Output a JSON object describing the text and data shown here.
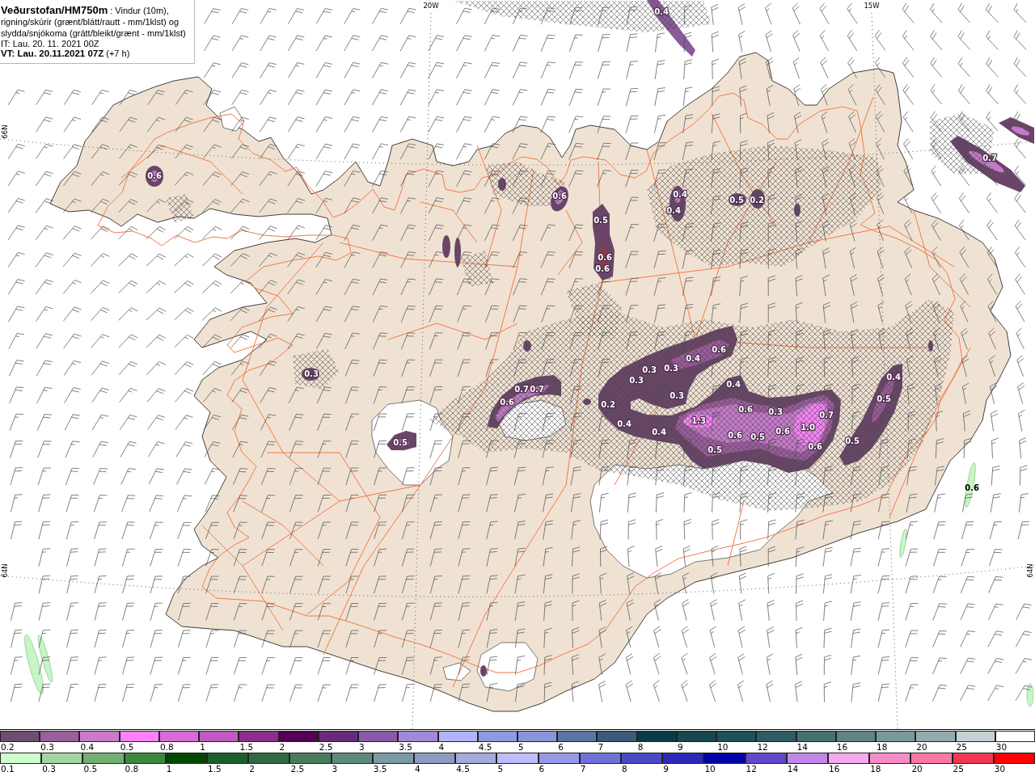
{
  "header": {
    "description": "**Veðurstofan/HM750m** : Vindur (10m), rigning/skúrir (grænt/blátt/rautt - mm/1klst) og slydda/snjókoma (grátt/bleikt/grænt - mm/1klst)",
    "initial_time": "IT: Lau. 20. 11. 2021 00Z",
    "valid_time": "**VT: Lau. 20.11.2021 07Z** (+7 h)"
  },
  "map": {
    "grid_labels": [
      {
        "text": "20W",
        "kind": "longitude"
      },
      {
        "text": "15W",
        "kind": "longitude"
      },
      {
        "text": "66N",
        "kind": "latitude"
      },
      {
        "text": "64N",
        "kind": "latitude"
      },
      {
        "text": "64N",
        "kind": "latitude"
      }
    ],
    "precipitation_labels": [
      {
        "text": "0.6",
        "kind": "snow"
      },
      {
        "text": "0.6",
        "kind": "snow"
      },
      {
        "text": "0.4",
        "kind": "snow"
      },
      {
        "text": "0.4",
        "kind": "snow"
      },
      {
        "text": "0.5",
        "kind": "snow"
      },
      {
        "text": "0.2",
        "kind": "snow"
      },
      {
        "text": "0.5",
        "kind": "snow"
      },
      {
        "text": "0.6",
        "kind": "snow"
      },
      {
        "text": "0.6",
        "kind": "snow"
      },
      {
        "text": "0.3",
        "kind": "snow"
      },
      {
        "text": "0.6",
        "kind": "snow"
      },
      {
        "text": "0.7",
        "kind": "snow"
      },
      {
        "text": "0.7",
        "kind": "snow"
      },
      {
        "text": "0.5",
        "kind": "snow"
      },
      {
        "text": "0.6",
        "kind": "snow"
      },
      {
        "text": "0.4",
        "kind": "snow"
      },
      {
        "text": "0.3",
        "kind": "snow"
      },
      {
        "text": "0.3",
        "kind": "snow"
      },
      {
        "text": "0.3",
        "kind": "snow"
      },
      {
        "text": "0.3",
        "kind": "snow"
      },
      {
        "text": "0.2",
        "kind": "snow"
      },
      {
        "text": "0.4",
        "kind": "snow"
      },
      {
        "text": "0.6",
        "kind": "snow"
      },
      {
        "text": "0.3",
        "kind": "snow"
      },
      {
        "text": "0.7",
        "kind": "snow"
      },
      {
        "text": "0.4",
        "kind": "snow"
      },
      {
        "text": "0.4",
        "kind": "snow"
      },
      {
        "text": "1.3",
        "kind": "snow"
      },
      {
        "text": "0.6",
        "kind": "snow"
      },
      {
        "text": "0.5",
        "kind": "snow"
      },
      {
        "text": "0.6",
        "kind": "snow"
      },
      {
        "text": "1.0",
        "kind": "snow"
      },
      {
        "text": "0.6",
        "kind": "snow"
      },
      {
        "text": "0.5",
        "kind": "snow"
      },
      {
        "text": "0.4",
        "kind": "snow"
      },
      {
        "text": "0.5",
        "kind": "snow"
      },
      {
        "text": "0.5",
        "kind": "snow"
      },
      {
        "text": "0.7",
        "kind": "snow"
      },
      {
        "text": "0.6",
        "kind": "rain"
      },
      {
        "text": "0.4",
        "kind": "snow"
      }
    ]
  },
  "legend": {
    "sleet_snow_scale": [
      {
        "label": "0.2",
        "color": "#6e4d6e"
      },
      {
        "label": "0.3",
        "color": "#9b5f9b"
      },
      {
        "label": "0.4",
        "color": "#c97bc9"
      },
      {
        "label": "0.5",
        "color": "#ff80ff"
      },
      {
        "label": "0.8",
        "color": "#d96bd9"
      },
      {
        "label": "1",
        "color": "#c259c2"
      },
      {
        "label": "1.5",
        "color": "#8c2e8c"
      },
      {
        "label": "2",
        "color": "#540054"
      },
      {
        "label": "2.5",
        "color": "#6a2a7a"
      },
      {
        "label": "3",
        "color": "#8a5aaa"
      },
      {
        "label": "3.5",
        "color": "#9e8ad6"
      },
      {
        "label": "4",
        "color": "#b0b4ff"
      },
      {
        "label": "4.5",
        "color": "#8c9ae0"
      },
      {
        "label": "5",
        "color": "#8a94d8"
      },
      {
        "label": "6",
        "color": "#5c74a4"
      },
      {
        "label": "7",
        "color": "#3a5a7a"
      },
      {
        "label": "8",
        "color": "#0a3c48"
      },
      {
        "label": "9",
        "color": "#16484e"
      },
      {
        "label": "10",
        "color": "#1e5058"
      },
      {
        "label": "12",
        "color": "#2e5c62"
      },
      {
        "label": "14",
        "color": "#46706e"
      },
      {
        "label": "16",
        "color": "#5e8484"
      },
      {
        "label": "18",
        "color": "#7a9898"
      },
      {
        "label": "20",
        "color": "#92acac"
      },
      {
        "label": "25",
        "color": "#c4d0d2"
      },
      {
        "label": "30",
        "color": "#ffffff"
      }
    ],
    "rain_scale": [
      {
        "label": "0.1",
        "color": "#ccffcc"
      },
      {
        "label": "0.3",
        "color": "#a0d8a0"
      },
      {
        "label": "0.5",
        "color": "#70b070"
      },
      {
        "label": "0.8",
        "color": "#3a8a3a"
      },
      {
        "label": "1",
        "color": "#004800"
      },
      {
        "label": "1.5",
        "color": "#1c5e2a"
      },
      {
        "label": "2",
        "color": "#306a40"
      },
      {
        "label": "2.5",
        "color": "#4a7a5e"
      },
      {
        "label": "3",
        "color": "#5e8a7e"
      },
      {
        "label": "3.5",
        "color": "#7a9aa6"
      },
      {
        "label": "4",
        "color": "#8c9cc0"
      },
      {
        "label": "4.5",
        "color": "#a4aadc"
      },
      {
        "label": "5",
        "color": "#bcbcff"
      },
      {
        "label": "6",
        "color": "#9898ea"
      },
      {
        "label": "7",
        "color": "#6e72d8"
      },
      {
        "label": "8",
        "color": "#4a4ac8"
      },
      {
        "label": "9",
        "color": "#2c28b8"
      },
      {
        "label": "10",
        "color": "#0000a8"
      },
      {
        "label": "12",
        "color": "#6048c8"
      },
      {
        "label": "14",
        "color": "#c088e8"
      },
      {
        "label": "16",
        "color": "#f8a8f0"
      },
      {
        "label": "18",
        "color": "#f88cc8"
      },
      {
        "label": "20",
        "color": "#f87aa4"
      },
      {
        "label": "25",
        "color": "#f03850"
      },
      {
        "label": "30",
        "color": "#ff0000"
      }
    ]
  }
}
